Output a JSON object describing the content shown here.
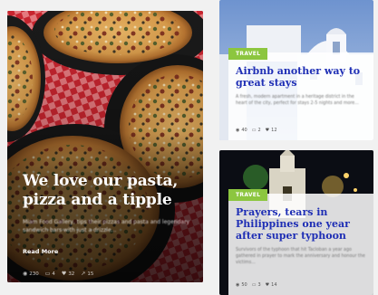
{
  "feature": {
    "title_line1": "We love our pasta,",
    "title_line2": "pizza and a tipple",
    "excerpt": "Miam Food Gallery, tips their pizzas and pasta and legendary sandwich bars with just a drizzle...",
    "read_more": "Read More",
    "meta": {
      "views": "230",
      "comments": "4",
      "likes": "32",
      "shares": "15"
    }
  },
  "cards": [
    {
      "category": "TRAVEL",
      "title": "Airbnb another way to great stays",
      "excerpt": "A fresh, modern apartment in a heritage district in the heart of the city, perfect for stays 2-5 nights and more...",
      "meta": {
        "views": "40",
        "comments": "2",
        "likes": "12"
      }
    },
    {
      "category": "TRAVEL",
      "title": "Prayers, tears in Philippines one year after super typhoon",
      "excerpt": "Survivors of the typhoon that hit Tacloban a year ago gathered in prayer to mark the anniversary and honour the victims...",
      "meta": {
        "views": "50",
        "comments": "3",
        "likes": "14"
      }
    }
  ],
  "colors": {
    "category_green": "#8cc63f",
    "headline_blue": "#1f2fb5",
    "checker_red": "#c8252f"
  },
  "icons": [
    "eye-icon",
    "comment-icon",
    "heart-icon",
    "share-icon"
  ]
}
